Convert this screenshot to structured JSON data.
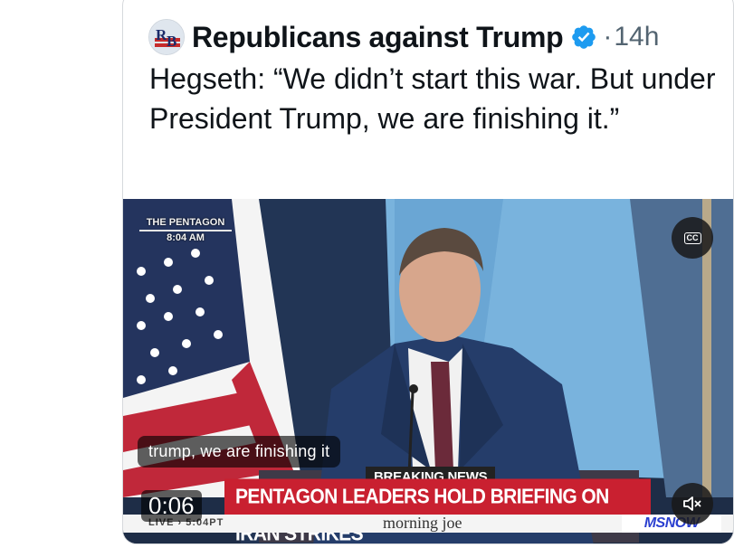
{
  "post": {
    "author": "Republicans against Trump",
    "avatar_text": "RB",
    "separator": "·",
    "time": "14h",
    "text": "Hegseth: “We didn’t start this war. But under President Trump, we are finishing it.”"
  },
  "video": {
    "location_tag": "THE PENTAGON",
    "location_time": "8:04 AM",
    "caption": "trump, we are finishing it",
    "breaking_label": "BREAKING NEWS",
    "headline": "PENTAGON LEADERS HOLD BRIEFING ON IRAN STRIKES",
    "live_label": "LIVE › 5:04PT",
    "show_name": "morning joe",
    "network": "MSNOW",
    "elapsed": "0:06",
    "cc_label": "CC"
  },
  "colors": {
    "verified": "#1d9bf0",
    "headline_bg": "#c92030",
    "network_blue": "#2a3fd0"
  },
  "icons": [
    "verified-badge-icon",
    "closed-captions-icon",
    "muted-speaker-icon"
  ]
}
